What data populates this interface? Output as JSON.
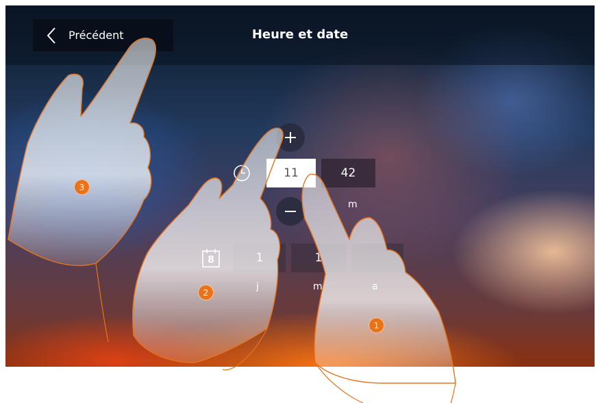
{
  "header": {
    "back_label": "Précédent",
    "title": "Heure et date"
  },
  "time": {
    "hour": "11",
    "minute": "42",
    "minute_unit": "m"
  },
  "date": {
    "day": "1",
    "month": "1",
    "day_unit": "j",
    "month_unit": "m",
    "year_unit": "a",
    "calendar_icon_number": "8"
  },
  "callouts": {
    "one": "1",
    "two": "2",
    "three": "3"
  },
  "colors": {
    "accent": "#e8731a",
    "active_field": "#ffffff"
  },
  "icons": [
    "back-chevron-icon",
    "plus-icon",
    "minus-icon",
    "clock-icon",
    "calendar-icon",
    "hand-illustration"
  ]
}
